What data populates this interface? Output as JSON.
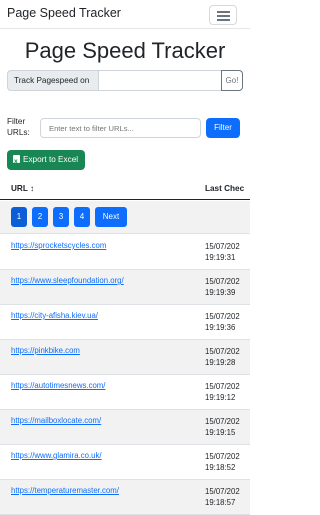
{
  "navbar": {
    "brand": "Page Speed Tracker"
  },
  "page_title": "Page Speed Tracker",
  "track": {
    "label": "Track Pagespeed on",
    "value": "",
    "go_label": "Go!"
  },
  "filter": {
    "label": "Filter URLs:",
    "placeholder": "Enter text to filter URLs...",
    "button_label": "Filter"
  },
  "export_label": "Export to Excel",
  "table": {
    "headers": {
      "url": "URL ↕",
      "last_checked": "Last Chec"
    },
    "pagination": {
      "pages": [
        "1",
        "2",
        "3",
        "4"
      ],
      "active_page": "1",
      "next_label": "Next"
    },
    "rows": [
      {
        "url": "https://sprocketscycles.com",
        "date": "15/07/202",
        "time": "19:19:31"
      },
      {
        "url": "https://www.sleepfoundation.org/",
        "date": "15/07/202",
        "time": "19:19:39"
      },
      {
        "url": "https://city-afisha.kiev.ua/",
        "date": "15/07/202",
        "time": "19:19:36"
      },
      {
        "url": "https://pinkbike.com",
        "date": "15/07/202",
        "time": "19:19:28"
      },
      {
        "url": "https://autotimesnews.com/",
        "date": "15/07/202",
        "time": "19:19:12"
      },
      {
        "url": "https://mailboxlocate.com/",
        "date": "15/07/202",
        "time": "19:19:15"
      },
      {
        "url": "https://www.glamira.co.uk/",
        "date": "15/07/202",
        "time": "19:18:52"
      },
      {
        "url": "https://temperaturemaster.com/",
        "date": "15/07/202",
        "time": "19:18:57"
      }
    ]
  },
  "colors": {
    "primary": "#0d6efd",
    "success": "#198754",
    "stripe": "#f2f2f2"
  }
}
